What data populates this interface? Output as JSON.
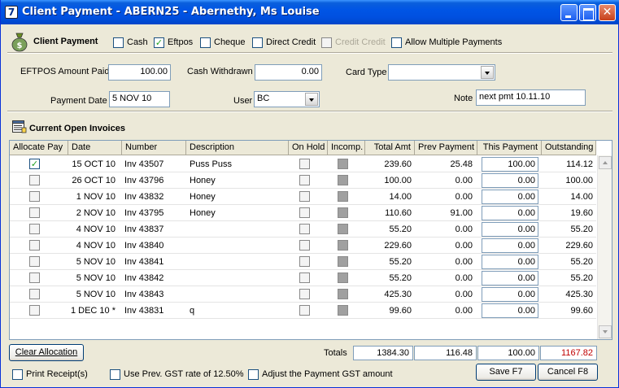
{
  "window": {
    "title": "Client Payment - ABERN25 - Abernethy, Ms Louise",
    "icon_glyph": "7"
  },
  "payment_header": {
    "label": "Client Payment",
    "options": [
      {
        "label": "Cash",
        "checked": false,
        "enabled": true
      },
      {
        "label": "Eftpos",
        "checked": true,
        "enabled": true
      },
      {
        "label": "Cheque",
        "checked": false,
        "enabled": true
      },
      {
        "label": "Direct Credit",
        "checked": false,
        "enabled": true
      },
      {
        "label": "Credit Credit",
        "checked": false,
        "enabled": false
      },
      {
        "label": "Allow Multiple Payments",
        "checked": false,
        "enabled": true
      }
    ]
  },
  "fields": {
    "eftpos_label": "EFTPOS Amount Paid",
    "eftpos_value": "100.00",
    "cash_label": "Cash Withdrawn",
    "cash_value": "0.00",
    "card_type_label": "Card Type",
    "card_type_value": "",
    "payment_date_label": "Payment Date",
    "payment_date_value": "5 NOV 10",
    "user_label": "User",
    "user_value": "BC",
    "note_label": "Note",
    "note_value": "next pmt 10.11.10"
  },
  "invoices": {
    "section_title": "Current Open Invoices",
    "columns": [
      "Allocate Pay",
      "Date",
      "Number",
      "Description",
      "On Hold",
      "Incomp.",
      "Total Amt",
      "Prev Payment",
      "This Payment",
      "Outstanding"
    ],
    "rows": [
      {
        "allocate": true,
        "date": "15 OCT 10",
        "number": "Inv 43507",
        "description": "Puss Puss",
        "on_hold": false,
        "total": "239.60",
        "prev": "25.48",
        "this": "100.00",
        "outstanding": "114.12"
      },
      {
        "allocate": false,
        "date": "26 OCT 10",
        "number": "Inv 43796",
        "description": "Honey",
        "on_hold": false,
        "total": "100.00",
        "prev": "0.00",
        "this": "0.00",
        "outstanding": "100.00"
      },
      {
        "allocate": false,
        "date": "1 NOV 10",
        "number": "Inv 43832",
        "description": "Honey",
        "on_hold": false,
        "total": "14.00",
        "prev": "0.00",
        "this": "0.00",
        "outstanding": "14.00"
      },
      {
        "allocate": false,
        "date": "2 NOV 10",
        "number": "Inv 43795",
        "description": "Honey",
        "on_hold": false,
        "total": "110.60",
        "prev": "91.00",
        "this": "0.00",
        "outstanding": "19.60"
      },
      {
        "allocate": false,
        "date": "4 NOV 10",
        "number": "Inv 43837",
        "description": "",
        "on_hold": false,
        "total": "55.20",
        "prev": "0.00",
        "this": "0.00",
        "outstanding": "55.20"
      },
      {
        "allocate": false,
        "date": "4 NOV 10",
        "number": "Inv 43840",
        "description": "",
        "on_hold": false,
        "total": "229.60",
        "prev": "0.00",
        "this": "0.00",
        "outstanding": "229.60"
      },
      {
        "allocate": false,
        "date": "5 NOV 10",
        "number": "Inv 43841",
        "description": "",
        "on_hold": false,
        "total": "55.20",
        "prev": "0.00",
        "this": "0.00",
        "outstanding": "55.20"
      },
      {
        "allocate": false,
        "date": "5 NOV 10",
        "number": "Inv 43842",
        "description": "",
        "on_hold": false,
        "total": "55.20",
        "prev": "0.00",
        "this": "0.00",
        "outstanding": "55.20"
      },
      {
        "allocate": false,
        "date": "5 NOV 10",
        "number": "Inv 43843",
        "description": "",
        "on_hold": false,
        "total": "425.30",
        "prev": "0.00",
        "this": "0.00",
        "outstanding": "425.30"
      },
      {
        "allocate": false,
        "date": "1 DEC 10 *",
        "number": "Inv 43831",
        "description": "q",
        "on_hold": false,
        "total": "99.60",
        "prev": "0.00",
        "this": "0.00",
        "outstanding": "99.60"
      }
    ]
  },
  "footer": {
    "clear_allocation_label": "Clear Allocation",
    "totals_label": "Totals",
    "total_amt": "1384.30",
    "total_prev": "116.48",
    "total_this": "100.00",
    "total_outstanding": "1167.82",
    "outstanding_color": "#c00000",
    "print_receipts_label": "Print Receipt(s)",
    "prev_gst_label": "Use Prev. GST rate of 12.50%",
    "adjust_gst_label": "Adjust the Payment GST amount",
    "save_label": "Save F7",
    "cancel_label": "Cancel F8"
  },
  "icons": {
    "header_icon": "money-bag-icon",
    "section_icon": "invoice-list-icon",
    "check_glyph": "✓"
  }
}
